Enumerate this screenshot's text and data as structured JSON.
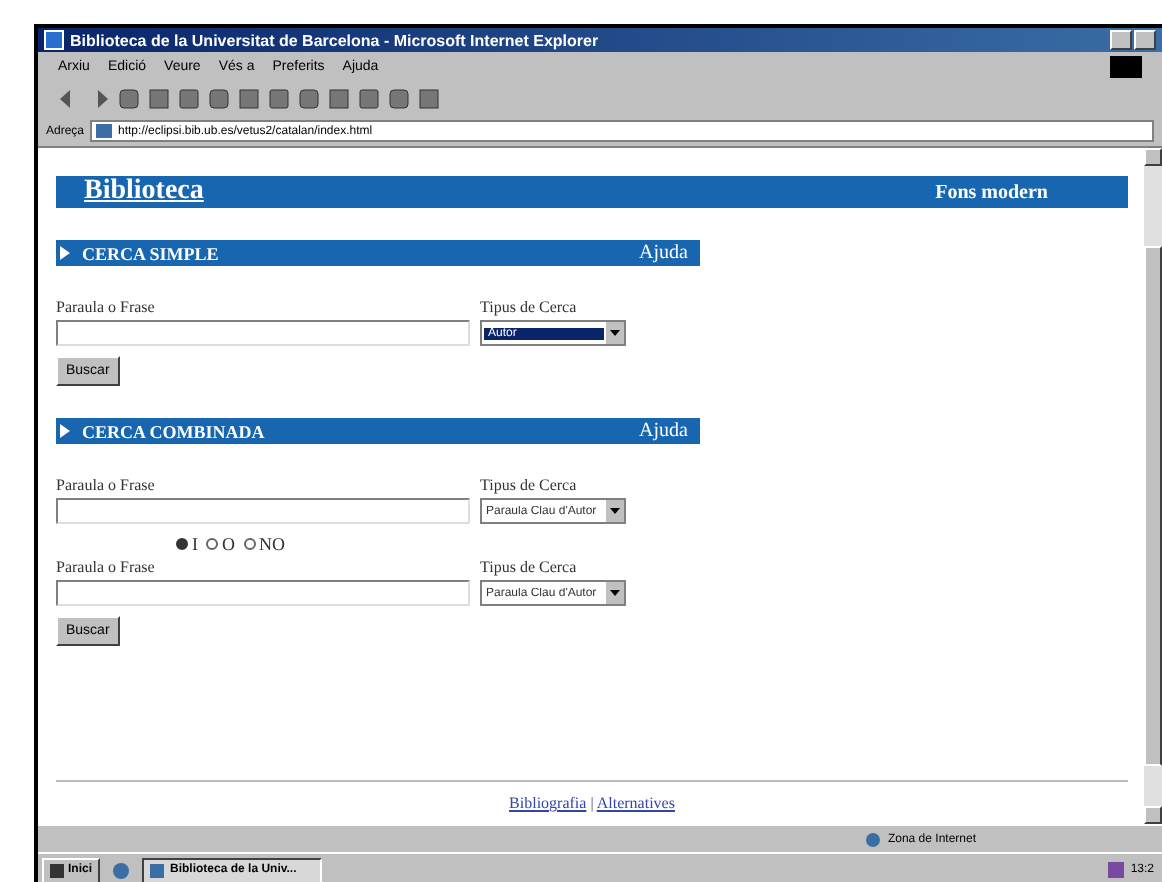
{
  "window": {
    "title": "Biblioteca de la Universitat de Barcelona - Microsoft Internet Explorer"
  },
  "menu": [
    "Arxiu",
    "Edició",
    "Veure",
    "Vés a",
    "Preferits",
    "Ajuda"
  ],
  "address": {
    "label": "Adreça",
    "value": "http://eclipsi.bib.ub.es/vetus2/catalan/index.html"
  },
  "header": {
    "title": "Biblioteca",
    "subtitle": "Fons modern"
  },
  "sections": [
    {
      "title": "CERCA SIMPLE",
      "help": "Ajuda",
      "rows": [
        {
          "field_label": "Paraula o Frase",
          "type_label": "Tipus de Cerca",
          "type_value": "Autor",
          "type_focused": true
        }
      ],
      "button": "Buscar"
    },
    {
      "title": "CERCA COMBINADA",
      "help": "Ajuda",
      "rows": [
        {
          "field_label": "Paraula o Frase",
          "type_label": "Tipus de Cerca",
          "type_value": "Paraula Clau d'Autor",
          "type_focused": false
        },
        {
          "field_label": "Paraula o Frase",
          "type_label": "Tipus de Cerca",
          "type_value": "Paraula Clau d'Autor",
          "type_focused": false
        }
      ],
      "operators": [
        {
          "label": "I",
          "selected": true
        },
        {
          "label": "O",
          "selected": false
        },
        {
          "label": "NO",
          "selected": false
        }
      ],
      "button": "Buscar"
    }
  ],
  "footer_links": [
    "Bibliografia",
    "Alternatives"
  ],
  "footer_separator": "|",
  "status_bar": {
    "zone": "Zona de Internet"
  },
  "taskbar": {
    "start": "Inici",
    "task": "Biblioteca de la Univ...",
    "clock": "13:2"
  }
}
